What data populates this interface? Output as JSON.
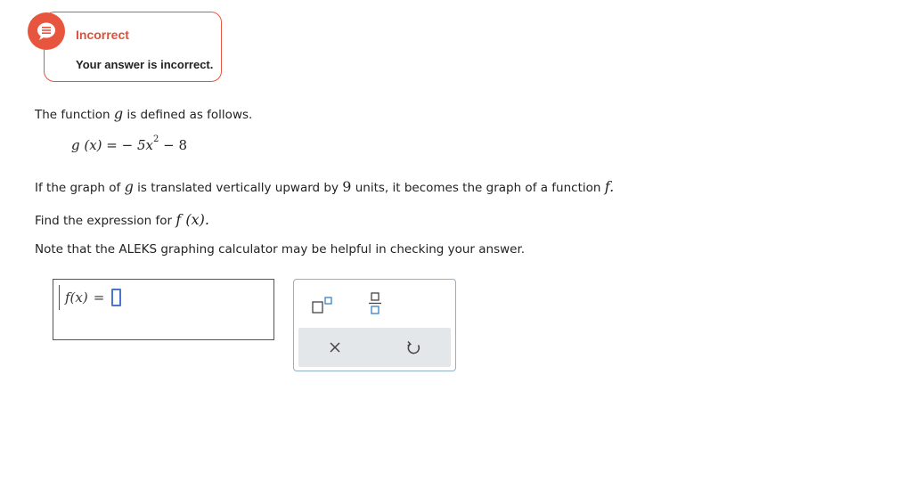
{
  "feedback": {
    "icon": "speech-bubble-icon",
    "title": "Incorrect",
    "message": "Your answer is incorrect.",
    "color": "#e8553e"
  },
  "problem": {
    "intro_before": "The function",
    "intro_var": "g",
    "intro_after": "is defined as follows.",
    "formula_lhs": "g (x) = − 5x",
    "formula_exp": "2",
    "formula_tail": " − 8",
    "translate_a": "If the graph of",
    "translate_var": "g",
    "translate_b": "is translated vertically upward by",
    "translate_num": "9",
    "translate_c": "units, it becomes the graph of a function",
    "translate_fn": "f.",
    "find_text": "Find the expression for",
    "find_expr": "f (x).",
    "note": "Note that the ALEKS graphing calculator may be helpful in checking your answer."
  },
  "answer": {
    "label": "f(x)",
    "equals": "="
  },
  "toolbar": {
    "superscript_icon": "superscript-icon",
    "fraction_icon": "fraction-icon",
    "clear_icon": "close-icon",
    "undo_icon": "undo-icon"
  }
}
